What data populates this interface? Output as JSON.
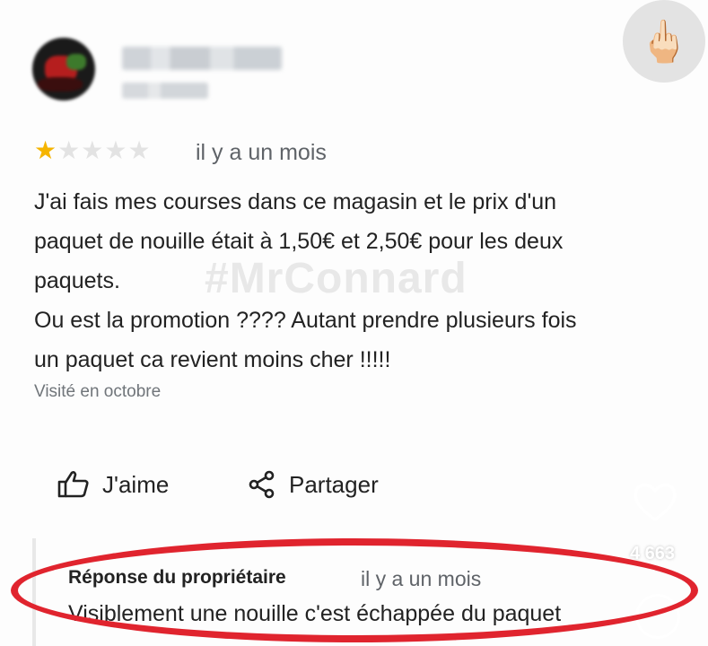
{
  "reviewer": {
    "name_blurred": "MrConnard",
    "meta_blurred": "185 avis"
  },
  "overlay": {
    "reaction_emoji": "🖕🏻",
    "likes_count": "4 663"
  },
  "review": {
    "rating": 1,
    "max_rating": 5,
    "time_ago": "il y a un mois",
    "text": "J'ai fais mes courses dans ce magasin et le prix d'un\npaquet de nouille était à 1,50€ et 2,50€ pour les deux\npaquets.\nOu est la promotion ???? Autant prendre plusieurs fois\nun paquet ca revient moins cher !!!!!",
    "watermark": "#MrConnard",
    "visited": "Visité en octobre"
  },
  "actions": {
    "like_label": "J'aime",
    "share_label": "Partager"
  },
  "owner_reply": {
    "title": "Réponse du propriétaire",
    "time_ago": "il y a un mois",
    "text": "Visiblement une nouille c'est échappée du paquet"
  },
  "colors": {
    "star_active": "#f5b400",
    "star_inactive": "#e3e3e3",
    "highlight_ellipse": "#e0242e"
  }
}
